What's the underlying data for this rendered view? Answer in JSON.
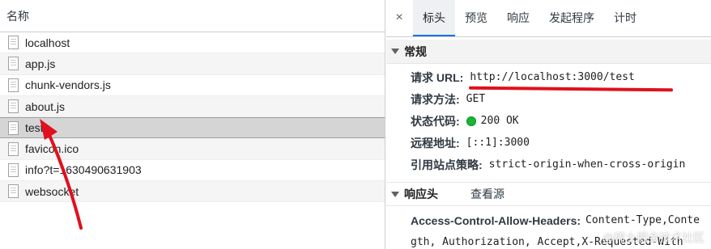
{
  "list": {
    "header": "名称",
    "rows": [
      {
        "label": "localhost"
      },
      {
        "label": "app.js"
      },
      {
        "label": "chunk-vendors.js"
      },
      {
        "label": "about.js"
      },
      {
        "label": "test",
        "selected": true
      },
      {
        "label": "favicon.ico"
      },
      {
        "label": "info?t=1630490631903"
      },
      {
        "label": "websocket"
      }
    ]
  },
  "tabs": {
    "close_glyph": "×",
    "items": [
      "标头",
      "预览",
      "响应",
      "发起程序",
      "计时"
    ],
    "active": "标头"
  },
  "general": {
    "title": "常规",
    "request_url_label": "请求 URL:",
    "request_url": "http://localhost:3000/test",
    "method_label": "请求方法:",
    "method": "GET",
    "status_label": "状态代码:",
    "status": "200 OK",
    "status_color": "#1cb33a",
    "remote_label": "远程地址:",
    "remote": "[::1]:3000",
    "referrer_label": "引用站点策略:",
    "referrer": "strict-origin-when-cross-origin"
  },
  "response_headers": {
    "title": "响应头",
    "view_source": "查看源",
    "line1_key": "Access-Control-Allow-Headers:",
    "line1_value": "Content-Type,Conte",
    "line2_value": "gth, Authorization, Accept,X-Requested-With"
  },
  "watermark": "@稀土掘金技术社区",
  "annotation_color": "#e0101e"
}
